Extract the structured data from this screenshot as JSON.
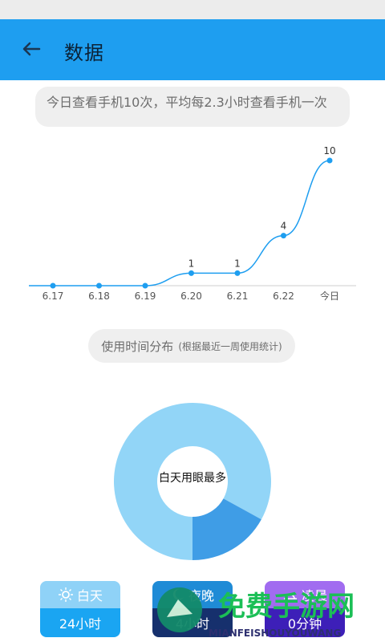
{
  "header": {
    "title": "数据"
  },
  "summary": {
    "text": "今日查看手机10次，平均每2.3小时查看手机一次"
  },
  "chart_data": {
    "type": "line",
    "categories": [
      "6.17",
      "6.18",
      "6.19",
      "6.20",
      "6.21",
      "6.22",
      "今日"
    ],
    "values": [
      0,
      0,
      0,
      1,
      1,
      4,
      10
    ],
    "data_labels": [
      "",
      "",
      "",
      "1",
      "1",
      "4",
      "10"
    ],
    "color": "#1e9ef0"
  },
  "distribution": {
    "title": "使用时间分布",
    "note": "(根据最近一周使用统计)",
    "center": "白天用眼最多"
  },
  "donut_data": {
    "day": 0.83,
    "night": 0.17,
    "colors": {
      "day": "#92d5f7",
      "night": "#3f9de6"
    }
  },
  "cards": [
    {
      "label": "白天",
      "value": "24小时"
    },
    {
      "label": "夜晚",
      "value": "4小时"
    },
    {
      "label": "凌晨",
      "value": "0分钟"
    }
  ],
  "watermark": {
    "text": "免费手游网",
    "sub": "MIANFEISHOUYOUWANG"
  }
}
